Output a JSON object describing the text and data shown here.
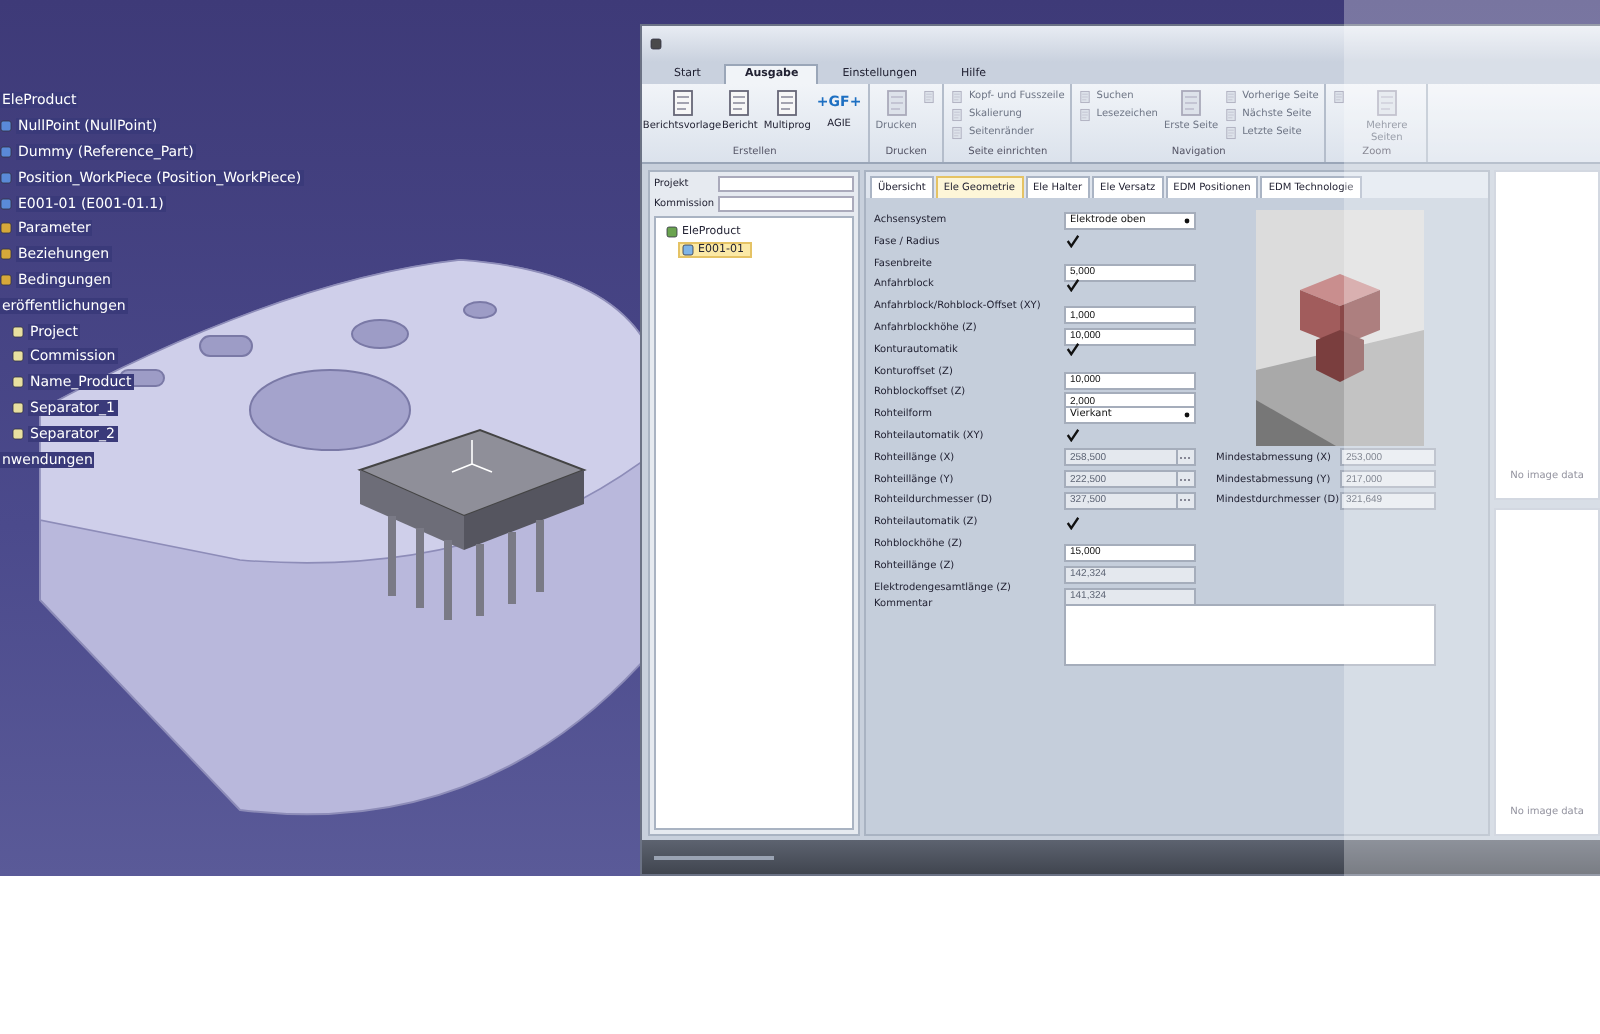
{
  "cad_tree": [
    {
      "label": "EleProduct",
      "kind": "heading"
    },
    {
      "label": "NullPoint (NullPoint)",
      "kind": "part"
    },
    {
      "label": "Dummy (Reference_Part)",
      "kind": "part"
    },
    {
      "label": "Position_WorkPiece (Position_WorkPiece)",
      "kind": "part"
    },
    {
      "label": "E001-01 (E001-01.1)",
      "kind": "part"
    },
    {
      "label": "Parameter",
      "kind": "param"
    },
    {
      "label": "Beziehungen",
      "kind": "param"
    },
    {
      "label": "Bedingungen",
      "kind": "param"
    },
    {
      "label": "eröffentlichungen",
      "kind": "heading",
      "children": [
        {
          "label": "Project",
          "kind": "publication"
        },
        {
          "label": "Commission",
          "kind": "publication"
        },
        {
          "label": "Name_Product",
          "kind": "publication"
        },
        {
          "label": "Separator_1",
          "kind": "publication"
        },
        {
          "label": "Separator_2",
          "kind": "publication"
        }
      ]
    },
    {
      "label": "nwendungen",
      "kind": "heading"
    }
  ],
  "ribbon": {
    "tabs": [
      {
        "label": "Start",
        "selected": false
      },
      {
        "label": "Ausgabe",
        "selected": true
      },
      {
        "label": "Einstellungen",
        "selected": false
      },
      {
        "label": "Hilfe",
        "selected": false
      }
    ],
    "groups": [
      {
        "label": "Erstellen",
        "buttons": [
          {
            "label": "Berichtsvorlage",
            "kind": "large",
            "disabled": false
          },
          {
            "label": "Bericht",
            "kind": "large",
            "disabled": false
          },
          {
            "label": "Multiprog",
            "kind": "large",
            "disabled": false
          },
          {
            "label": "AGIE",
            "kind": "logo",
            "logo": "+GF+",
            "disabled": false
          }
        ]
      },
      {
        "label": "Drucken",
        "buttons": [
          {
            "label": "Drucken",
            "kind": "large",
            "disabled": true
          },
          {
            "kind": "small",
            "disabled": true
          }
        ]
      },
      {
        "label": "Seite einrichten",
        "buttons": [
          {
            "label": "Kopf- und Fusszeile",
            "kind": "small",
            "disabled": true
          },
          {
            "label": "Skalierung",
            "kind": "small",
            "disabled": true
          },
          {
            "label": "Seitenränder",
            "kind": "small",
            "disabled": true
          }
        ]
      },
      {
        "label": "Navigation",
        "buttons": [
          {
            "label": "Suchen",
            "kind": "small",
            "disabled": true
          },
          {
            "label": "Lesezeichen",
            "kind": "small",
            "disabled": true
          },
          {
            "label": "Erste Seite",
            "kind": "large",
            "disabled": true
          },
          {
            "label": "Vorherige Seite",
            "kind": "small",
            "disabled": true
          },
          {
            "label": "Nächste Seite",
            "kind": "small",
            "disabled": true
          },
          {
            "label": "Letzte Seite",
            "kind": "small",
            "disabled": true
          }
        ]
      },
      {
        "label": "Zoom",
        "buttons": [
          {
            "kind": "small",
            "disabled": true
          },
          {
            "label": "Mehrere Seiten",
            "kind": "large",
            "disabled": true
          }
        ]
      }
    ]
  },
  "left_panel": {
    "fields": [
      {
        "label": "Projekt"
      },
      {
        "label": "Kommission"
      }
    ],
    "tree": [
      {
        "label": "EleProduct",
        "selected": false,
        "children": [
          {
            "label": "E001-01",
            "selected": true
          }
        ]
      }
    ]
  },
  "form_tabs": [
    {
      "label": "Übersicht",
      "selected": false
    },
    {
      "label": "Ele Geometrie",
      "selected": true
    },
    {
      "label": "Ele Halter",
      "selected": false
    },
    {
      "label": "Ele Versatz",
      "selected": false
    },
    {
      "label": "EDM Positionen",
      "selected": false
    },
    {
      "label": "EDM Technologie",
      "selected": false
    }
  ],
  "form": [
    {
      "label": "Achsensystem",
      "kind": "select",
      "value": "Elektrode oben"
    },
    {
      "label": "Fase / Radius",
      "kind": "check",
      "checked": true
    },
    {
      "label": "Fasenbreite",
      "kind": "number",
      "value": "5,000",
      "disabled": false
    },
    {
      "label": "Anfahrblock",
      "kind": "check",
      "checked": true
    },
    {
      "label": "Anfahrblock/Rohblock-Offset (XY)",
      "kind": "number",
      "value": "1,000",
      "disabled": false
    },
    {
      "label": "Anfahrblockhöhe (Z)",
      "kind": "number",
      "value": "10,000",
      "disabled": false
    },
    {
      "label": "Konturautomatik",
      "kind": "check",
      "checked": true
    },
    {
      "label": "Konturoffset (Z)",
      "kind": "number",
      "value": "10,000",
      "disabled": false
    },
    {
      "label": "Rohblockoffset (Z)",
      "kind": "number",
      "value": "2,000",
      "disabled": false
    },
    {
      "label": "Rohteilform",
      "kind": "select",
      "value": "Vierkant"
    },
    {
      "label": "Rohteilautomatik (XY)",
      "kind": "check",
      "checked": true
    },
    {
      "label": "Rohteillänge (X)",
      "kind": "browse",
      "value": "258,500",
      "disabled": true,
      "side": {
        "label": "Mindestabmessung (X)",
        "value": "253,000"
      }
    },
    {
      "label": "Rohteillänge (Y)",
      "kind": "browse",
      "value": "222,500",
      "disabled": true,
      "side": {
        "label": "Mindestabmessung (Y)",
        "value": "217,000"
      }
    },
    {
      "label": "Rohteildurchmesser (D)",
      "kind": "browse",
      "value": "327,500",
      "disabled": true,
      "side": {
        "label": "Mindestdurchmesser (D)",
        "value": "321,649"
      }
    },
    {
      "label": "Rohteilautomatik (Z)",
      "kind": "check",
      "checked": true
    },
    {
      "label": "Rohblockhöhe (Z)",
      "kind": "number",
      "value": "15,000",
      "disabled": false
    },
    {
      "label": "Rohteillänge (Z)",
      "kind": "number",
      "value": "142,324",
      "disabled": true
    },
    {
      "label": "Elektrodengesamtlänge (Z)",
      "kind": "number",
      "value": "141,324",
      "disabled": true
    },
    {
      "label": "Kommentar",
      "kind": "textarea"
    }
  ],
  "right_panel": {
    "images": [
      "No image data",
      "No image data"
    ]
  }
}
